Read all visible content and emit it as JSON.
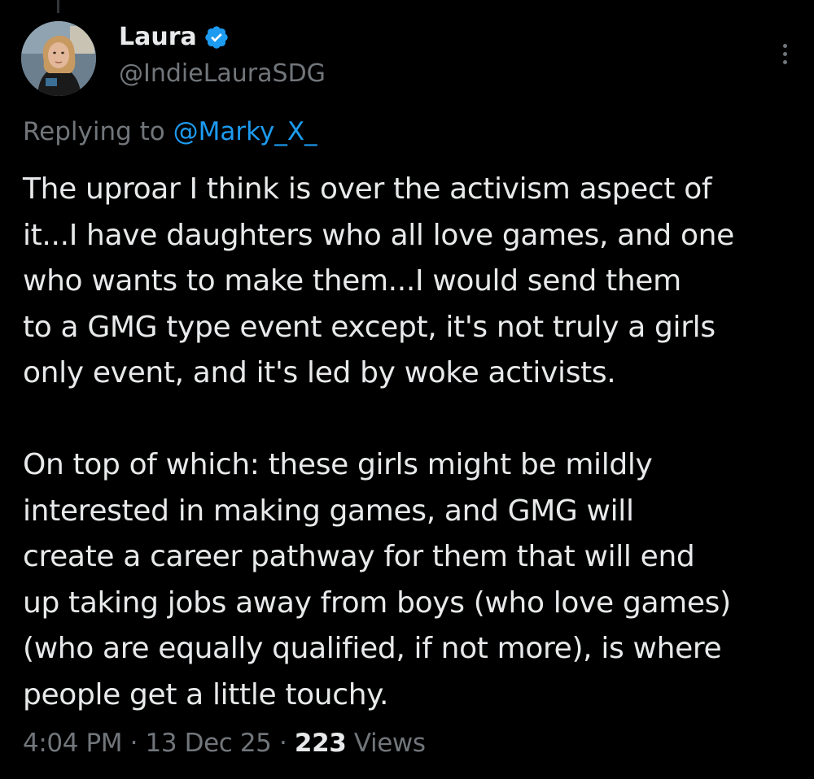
{
  "theme": {
    "background": "#000000",
    "text": "#e7e9ea",
    "muted": "#71767b",
    "link": "#1d9bf0",
    "verified_badge": "#1d9bf0"
  },
  "author": {
    "name": "Laura",
    "handle": "@IndieLauraSDG",
    "verified": true,
    "avatar_icon": "profile-photo"
  },
  "reply_context": {
    "prefix": "Replying to",
    "mention": "@Marky_X_"
  },
  "tweet": {
    "paragraph_1": [
      "The uproar I think is over the activism aspect of",
      "it...I have daughters who all love games, and one",
      "who wants to make them...I would send them",
      "to a GMG type event except, it's not truly a girls",
      "only event, and it's led by woke activists."
    ],
    "paragraph_2": [
      "On top of which: these girls might be mildly",
      "interested in making games, and GMG will",
      "create a career pathway for them that will end",
      "up taking jobs away from boys (who love games)",
      "(who are equally qualified, if not more), is where",
      "people get a little touchy."
    ]
  },
  "meta": {
    "time": "4:04 PM",
    "separator": "·",
    "date": "13 Dec 25",
    "views_count": "223",
    "views_label": "Views"
  },
  "icons": {
    "more": "more-options-icon",
    "verified": "verified-badge-icon"
  }
}
